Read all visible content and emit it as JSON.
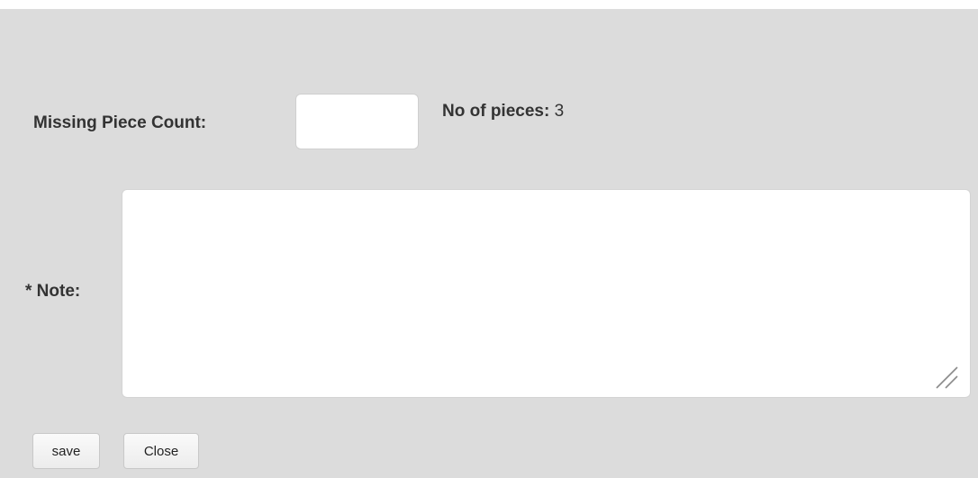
{
  "form": {
    "missing_count": {
      "label": "Missing Piece Count:",
      "value": ""
    },
    "pieces": {
      "label": "No of pieces:",
      "value": "3"
    },
    "note": {
      "label": "* Note:",
      "value": ""
    }
  },
  "buttons": {
    "save_label": "save",
    "close_label": "Close"
  },
  "colors": {
    "panel_background": "#dcdcdc",
    "label_text": "#333333",
    "input_background": "#ffffff"
  },
  "icons": {
    "textarea_resize": "resize-handle-icon"
  }
}
